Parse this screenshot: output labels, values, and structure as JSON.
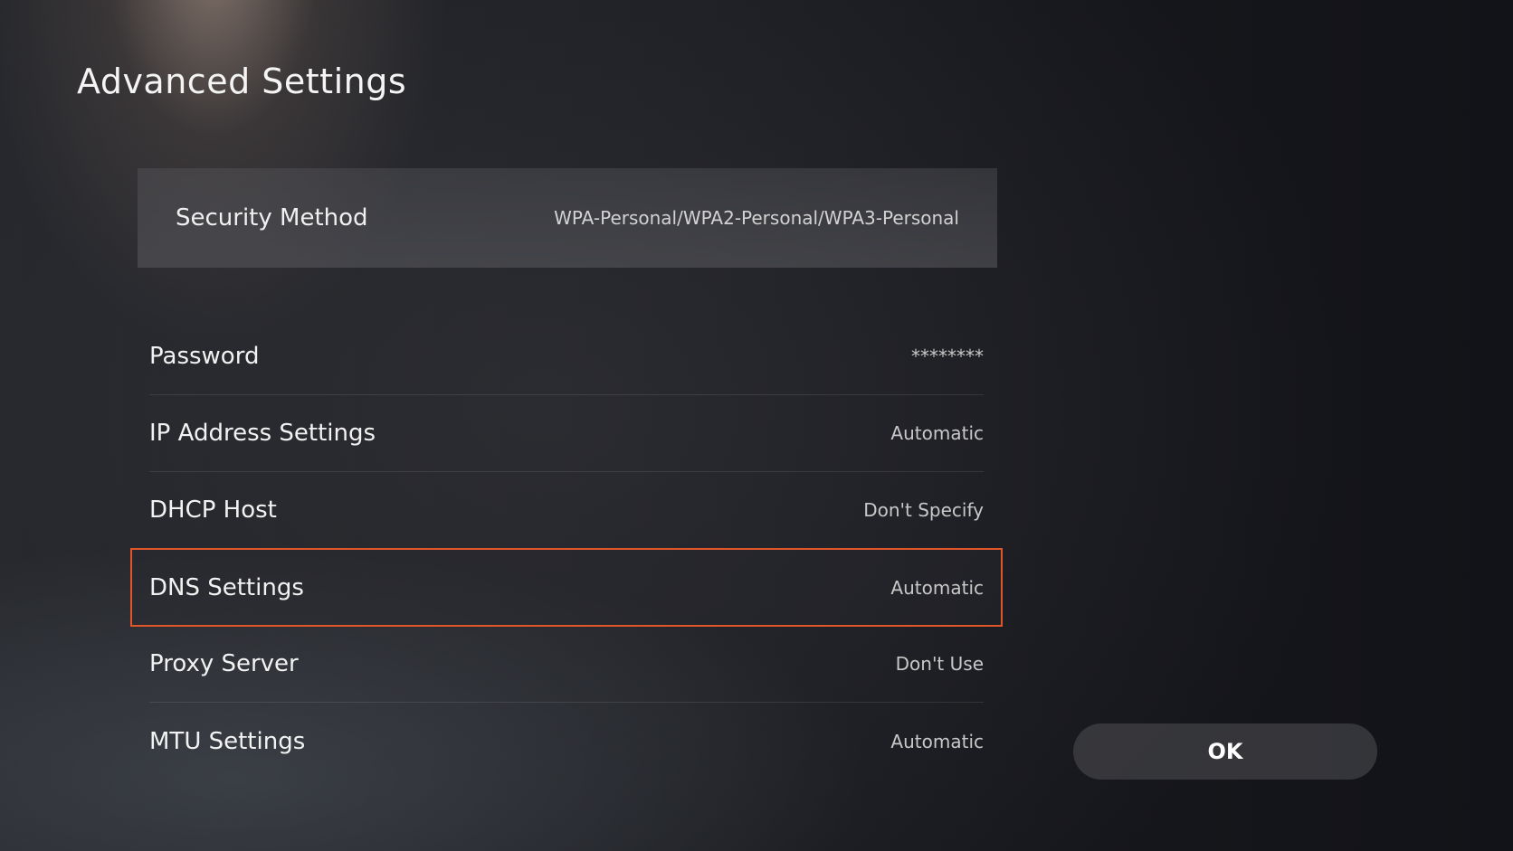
{
  "page": {
    "title": "Advanced Settings"
  },
  "security": {
    "label": "Security Method",
    "value": "WPA-Personal/WPA2-Personal/WPA3-Personal"
  },
  "settings": [
    {
      "label": "Password",
      "value": "********"
    },
    {
      "label": "IP Address Settings",
      "value": "Automatic"
    },
    {
      "label": "DHCP Host",
      "value": "Don't Specify"
    },
    {
      "label": "DNS Settings",
      "value": "Automatic"
    },
    {
      "label": "Proxy Server",
      "value": "Don't Use"
    },
    {
      "label": "MTU Settings",
      "value": "Automatic"
    }
  ],
  "focused_item": "DNS Settings",
  "ok_button": {
    "label": "OK"
  },
  "colors": {
    "focus_border": "#e0562a",
    "background": "#1c1e23"
  }
}
